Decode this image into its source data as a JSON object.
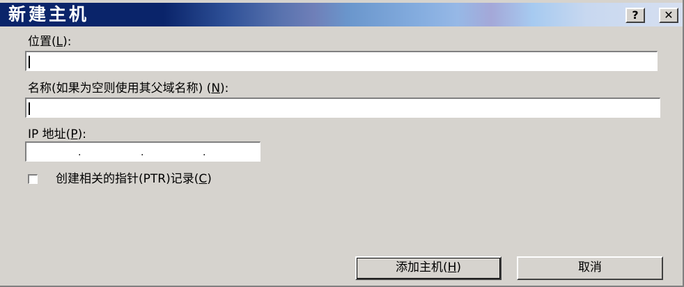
{
  "window": {
    "title": "新建主机",
    "help_glyph": "?",
    "close_glyph": "✕"
  },
  "location": {
    "label": "位置",
    "accel": "L",
    "value": ""
  },
  "name": {
    "label": "名称(如果为空则使用其父域名称)",
    "accel": "N",
    "value": ""
  },
  "ip": {
    "label": "IP 地址",
    "accel": "P",
    "separator": "."
  },
  "ptr": {
    "label": "创建相关的指针(PTR)记录",
    "accel": "C",
    "checked": false
  },
  "buttons": {
    "add_host": "添加主机",
    "add_host_accel": "H",
    "cancel": "取消"
  },
  "colors": {
    "titlebar_start": "#0a246a",
    "titlebar_end": "#a6caf0",
    "dialog_face": "#d6d3ce"
  }
}
